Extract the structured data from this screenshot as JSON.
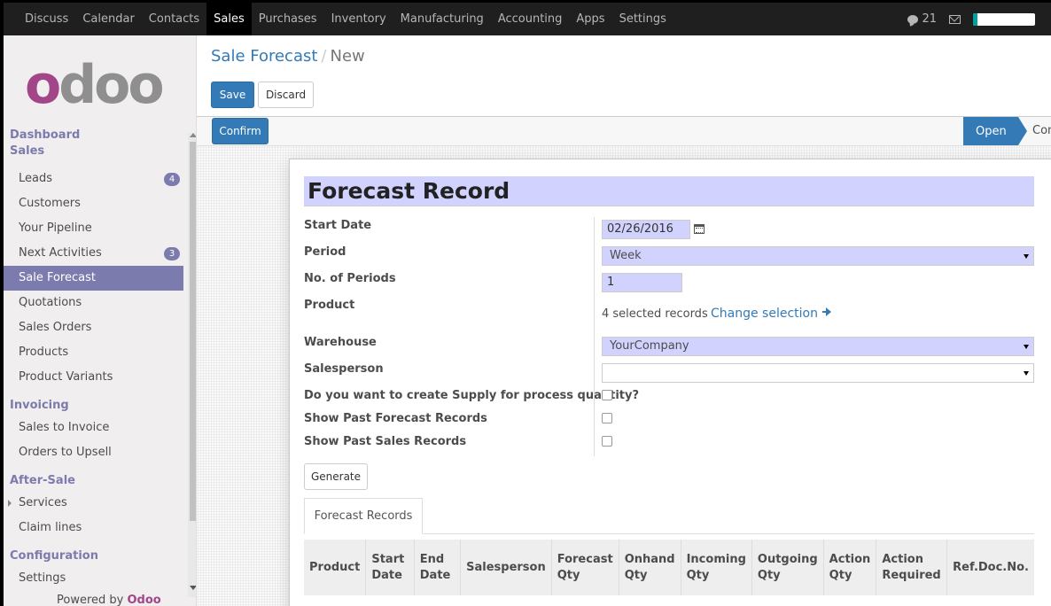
{
  "topnav": {
    "menu": [
      "Discuss",
      "Calendar",
      "Contacts",
      "Sales",
      "Purchases",
      "Inventory",
      "Manufacturing",
      "Accounting",
      "Apps",
      "Settings"
    ],
    "active": "Sales",
    "messages_count": "21"
  },
  "sidebar": {
    "logo": {
      "first": "o",
      "rest": "doo"
    },
    "sections": [
      {
        "title": "Dashboard",
        "items": []
      },
      {
        "title": "Sales",
        "items": [
          {
            "label": "Leads",
            "badge": "4"
          },
          {
            "label": "Customers"
          },
          {
            "label": "Your Pipeline"
          },
          {
            "label": "Next Activities",
            "badge": "3"
          },
          {
            "label": "Sale Forecast",
            "active": true
          },
          {
            "label": "Quotations"
          },
          {
            "label": "Sales Orders"
          },
          {
            "label": "Products"
          },
          {
            "label": "Product Variants"
          }
        ]
      },
      {
        "title": "Invoicing",
        "items": [
          {
            "label": "Sales to Invoice"
          },
          {
            "label": "Orders to Upsell"
          }
        ]
      },
      {
        "title": "After-Sale",
        "items": [
          {
            "label": "Services",
            "caret": true
          },
          {
            "label": "Claim lines"
          }
        ]
      },
      {
        "title": "Configuration",
        "items": [
          {
            "label": "Settings"
          }
        ]
      }
    ],
    "powered_by": "Powered by",
    "powered_brand": "Odoo"
  },
  "breadcrumb": {
    "parent": "Sale Forecast",
    "separator": "/",
    "current": "New"
  },
  "buttons": {
    "save": "Save",
    "discard": "Discard",
    "confirm": "Confirm",
    "generate": "Generate"
  },
  "status": {
    "current": "Open",
    "next": "Con"
  },
  "form": {
    "title": "Forecast Record",
    "fields": {
      "start_date": {
        "label": "Start Date",
        "value": "02/26/2016"
      },
      "period": {
        "label": "Period",
        "value": "Week"
      },
      "num_periods": {
        "label": "No. of Periods",
        "value": "1"
      },
      "product": {
        "label": "Product",
        "selected": "4 selected records",
        "change": "Change selection"
      },
      "warehouse": {
        "label": "Warehouse",
        "value": "YourCompany"
      },
      "salesperson": {
        "label": "Salesperson",
        "value": ""
      },
      "create_supply": {
        "label": "Do you want to create Supply for process quantity?",
        "checked": false
      },
      "show_past_forecast": {
        "label": "Show Past Forecast Records",
        "checked": false
      },
      "show_past_sales": {
        "label": "Show Past Sales Records",
        "checked": false
      }
    },
    "tab": "Forecast Records",
    "table_headers": [
      [
        "Product"
      ],
      [
        "Start Date"
      ],
      [
        "End Date"
      ],
      [
        "Salesperson"
      ],
      [
        "Forecast",
        "Qty"
      ],
      [
        "Onhand",
        "Qty"
      ],
      [
        "Incoming",
        "Qty"
      ],
      [
        "Outgoing",
        "Qty"
      ],
      [
        "Action",
        "Qty"
      ],
      [
        "Action",
        "Required"
      ],
      [
        "Ref.Doc.No."
      ]
    ]
  }
}
